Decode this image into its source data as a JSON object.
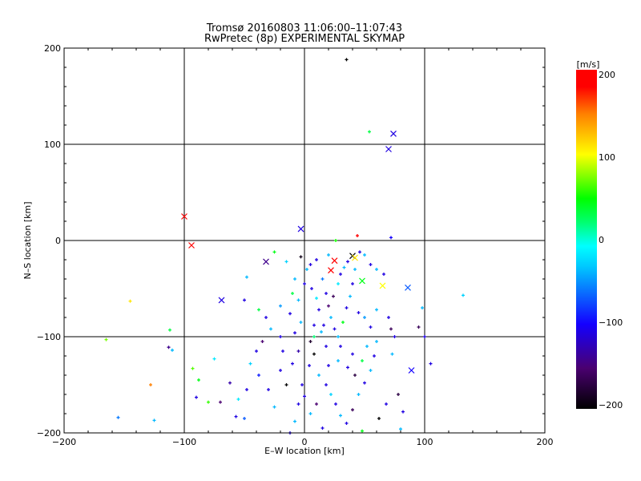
{
  "chart_data": {
    "type": "scatter",
    "title": "Tromsø 20160803 11:06:00–11:07:43",
    "subtitle": "RwPretec (8p) EXPERIMENTAL SKYMAP",
    "xlabel": "E–W location [km]",
    "ylabel": "N–S location [km]",
    "xlim": [
      -200,
      200
    ],
    "ylim": [
      -200,
      200
    ],
    "xticks": [
      "−200",
      "−100",
      "0",
      "100",
      "200"
    ],
    "yticks": [
      "−200",
      "−100",
      "0",
      "100",
      "200"
    ],
    "xtick_values": [
      -200,
      -100,
      0,
      100,
      200
    ],
    "ytick_values": [
      -200,
      -100,
      0,
      100,
      200
    ],
    "grid": true,
    "colorbar": {
      "label": "[m/s]",
      "range": [
        -200,
        200
      ],
      "ticks": [
        "200",
        "100",
        "0",
        "−100",
        "−200"
      ],
      "tick_values": [
        200,
        100,
        0,
        -100,
        -200
      ]
    },
    "cross_points": [
      [
        -100,
        25,
        190
      ],
      [
        -94,
        -5,
        185
      ],
      [
        -3,
        12,
        -110
      ],
      [
        70,
        95,
        -110
      ],
      [
        74,
        111,
        -110
      ],
      [
        -32,
        -22,
        -140
      ],
      [
        -69,
        -62,
        -110
      ],
      [
        89,
        -135,
        -100
      ],
      [
        86,
        -49,
        -70
      ],
      [
        65,
        -47,
        100
      ],
      [
        48,
        -42,
        20
      ],
      [
        25,
        -21,
        195
      ],
      [
        22,
        -31,
        190
      ],
      [
        40,
        -16,
        -200
      ],
      [
        42,
        -18,
        110
      ]
    ],
    "points": [
      [
        35,
        188,
        -200
      ],
      [
        54,
        113,
        10
      ],
      [
        72,
        3,
        -100
      ],
      [
        44,
        5,
        180
      ],
      [
        26,
        0,
        30
      ],
      [
        -3,
        -17,
        -190
      ],
      [
        -25,
        -12,
        20
      ],
      [
        -15,
        -22,
        -30
      ],
      [
        -48,
        -38,
        -40
      ],
      [
        -50,
        -62,
        -110
      ],
      [
        -145,
        -63,
        110
      ],
      [
        -165,
        -103,
        60
      ],
      [
        -112,
        -93,
        10
      ],
      [
        -113,
        -111,
        -140
      ],
      [
        -110,
        -114,
        -40
      ],
      [
        -93,
        -133,
        50
      ],
      [
        -128,
        -150,
        150
      ],
      [
        -155,
        -184,
        -60
      ],
      [
        -125,
        -187,
        -40
      ],
      [
        -75,
        -123,
        -20
      ],
      [
        -88,
        -145,
        20
      ],
      [
        -90,
        -163,
        -110
      ],
      [
        -62,
        -148,
        -130
      ],
      [
        -80,
        -168,
        40
      ],
      [
        -57,
        -183,
        -110
      ],
      [
        -70,
        -168,
        -150
      ],
      [
        -50,
        -185,
        -70
      ],
      [
        -55,
        -165,
        -20
      ],
      [
        -30,
        -155,
        -110
      ],
      [
        -25,
        -173,
        -40
      ],
      [
        -15,
        -150,
        -200
      ],
      [
        -10,
        -128,
        -110
      ],
      [
        -5,
        -115,
        -130
      ],
      [
        5,
        -105,
        -180
      ],
      [
        8,
        -88,
        -110
      ],
      [
        -8,
        -96,
        -110
      ],
      [
        -20,
        -100,
        -110
      ],
      [
        -35,
        -105,
        -150
      ],
      [
        -40,
        -115,
        -110
      ],
      [
        -45,
        -128,
        -30
      ],
      [
        -38,
        -140,
        -90
      ],
      [
        -48,
        -155,
        -110
      ],
      [
        -20,
        -135,
        -110
      ],
      [
        -18,
        -115,
        -110
      ],
      [
        -28,
        -92,
        -40
      ],
      [
        -32,
        -80,
        -110
      ],
      [
        -38,
        -72,
        10
      ],
      [
        -20,
        -68,
        -50
      ],
      [
        -12,
        -76,
        -110
      ],
      [
        -5,
        -62,
        -40
      ],
      [
        0,
        -45,
        -110
      ],
      [
        2,
        -30,
        -40
      ],
      [
        6,
        -50,
        -110
      ],
      [
        10,
        -60,
        -20
      ],
      [
        12,
        -72,
        -110
      ],
      [
        15,
        -40,
        -60
      ],
      [
        18,
        -55,
        -110
      ],
      [
        20,
        -68,
        -150
      ],
      [
        22,
        -80,
        -40
      ],
      [
        25,
        -92,
        -110
      ],
      [
        28,
        -100,
        -40
      ],
      [
        30,
        -110,
        -110
      ],
      [
        32,
        -85,
        20
      ],
      [
        35,
        -70,
        -110
      ],
      [
        38,
        -58,
        -40
      ],
      [
        40,
        -45,
        -110
      ],
      [
        42,
        -30,
        -40
      ],
      [
        30,
        -35,
        -110
      ],
      [
        33,
        -28,
        -40
      ],
      [
        36,
        -22,
        -110
      ],
      [
        28,
        -45,
        -20
      ],
      [
        24,
        -58,
        -160
      ],
      [
        16,
        -88,
        -110
      ],
      [
        8,
        -118,
        -200
      ],
      [
        4,
        -130,
        -110
      ],
      [
        12,
        -140,
        -40
      ],
      [
        18,
        -150,
        -110
      ],
      [
        22,
        -160,
        -30
      ],
      [
        26,
        -170,
        -110
      ],
      [
        30,
        -182,
        -40
      ],
      [
        35,
        -190,
        -110
      ],
      [
        40,
        -176,
        -160
      ],
      [
        45,
        -160,
        -40
      ],
      [
        50,
        -148,
        -110
      ],
      [
        55,
        -135,
        -40
      ],
      [
        58,
        -120,
        -110
      ],
      [
        60,
        -105,
        -40
      ],
      [
        55,
        -90,
        -110
      ],
      [
        50,
        -80,
        -50
      ],
      [
        45,
        -75,
        -110
      ],
      [
        60,
        -72,
        -40
      ],
      [
        70,
        -80,
        -110
      ],
      [
        72,
        -92,
        -160
      ],
      [
        75,
        -100,
        -110
      ],
      [
        73,
        -118,
        -40
      ],
      [
        78,
        -160,
        -170
      ],
      [
        82,
        -178,
        -110
      ],
      [
        80,
        -196,
        -40
      ],
      [
        62,
        -185,
        -200
      ],
      [
        68,
        -170,
        -110
      ],
      [
        15,
        -195,
        -110
      ],
      [
        5,
        -180,
        -40
      ],
      [
        -5,
        -170,
        -110
      ],
      [
        -8,
        -188,
        -40
      ],
      [
        -12,
        -200,
        -110
      ],
      [
        0,
        -162,
        -110
      ],
      [
        10,
        -170,
        -150
      ],
      [
        48,
        -198,
        20
      ],
      [
        -2,
        -150,
        -110
      ],
      [
        20,
        -130,
        -110
      ],
      [
        28,
        -125,
        -40
      ],
      [
        36,
        -132,
        -110
      ],
      [
        42,
        -140,
        -170
      ],
      [
        48,
        -125,
        10
      ],
      [
        40,
        -118,
        -110
      ],
      [
        52,
        -110,
        -40
      ],
      [
        8,
        -100,
        0
      ],
      [
        14,
        -95,
        -40
      ],
      [
        18,
        -110,
        -110
      ],
      [
        -3,
        -85,
        -40
      ],
      [
        98,
        -70,
        -40
      ],
      [
        100,
        -100,
        -110
      ],
      [
        105,
        -128,
        -110
      ],
      [
        132,
        -57,
        -30
      ],
      [
        95,
        -90,
        -160
      ],
      [
        60,
        -30,
        -40
      ],
      [
        66,
        -35,
        -110
      ],
      [
        55,
        -25,
        -110
      ],
      [
        50,
        -15,
        -40
      ],
      [
        46,
        -12,
        -110
      ],
      [
        20,
        -15,
        -40
      ],
      [
        10,
        -20,
        -110
      ],
      [
        5,
        -25,
        -110
      ],
      [
        -8,
        -40,
        -40
      ],
      [
        -10,
        -55,
        10
      ]
    ]
  }
}
